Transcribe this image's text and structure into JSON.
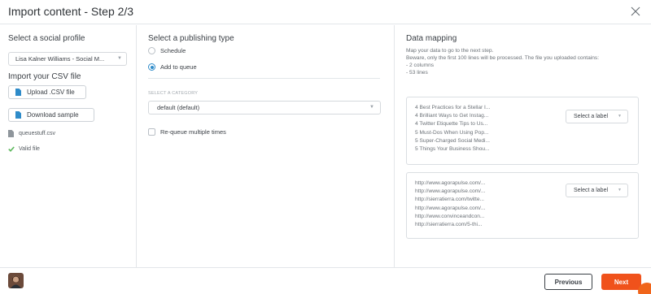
{
  "header": {
    "title": "Import content - Step 2/3"
  },
  "profile": {
    "heading": "Select a social profile",
    "selected": "Lisa Kalner Williams - Social M...",
    "csv_heading": "Import your CSV file",
    "upload_label": "Upload .CSV file",
    "download_label": "Download sample",
    "file_name": "queuestuff.csv",
    "valid_text": "Valid file"
  },
  "publishing": {
    "heading": "Select a publishing type",
    "options": [
      {
        "label": "Schedule",
        "selected": false
      },
      {
        "label": "Add to queue",
        "selected": true
      }
    ],
    "category_label": "SELECT A CATEGORY",
    "category_value": "default  (default)",
    "requeue_label": "Re-queue multiple times"
  },
  "mapping": {
    "heading": "Data mapping",
    "desc": [
      "Map your data to go to the next step.",
      "Beware, only the first 100 lines will be processed. The file you uploaded contains:",
      "- 2 columns",
      "- 53 lines"
    ],
    "columns": [
      {
        "select_label": "Select a label",
        "lines": [
          "4 Best Practices for a Stellar I...",
          "4 Brilliant Ways to Get Instag...",
          "4 Twitter Etiquette Tips to Us...",
          "5 Must-Dos When Using Pop...",
          "5 Super-Charged Social Medi...",
          "5 Things Your Business Shou..."
        ]
      },
      {
        "select_label": "Select a label",
        "lines": [
          "http://www.agorapulse.com/...",
          "http://www.agorapulse.com/...",
          "http://sierratierra.com/twitte...",
          "http://www.agorapulse.com/...",
          "http://www.convinceandcon...",
          "http://sierratierra.com/5-thi..."
        ]
      }
    ]
  },
  "footer": {
    "previous_label": "Previous",
    "next_label": "Next"
  },
  "colors": {
    "accent": "#f0521b",
    "radio": "#2e8bc9",
    "valid": "#5cb85c",
    "link_icon": "#2e8bc9"
  }
}
